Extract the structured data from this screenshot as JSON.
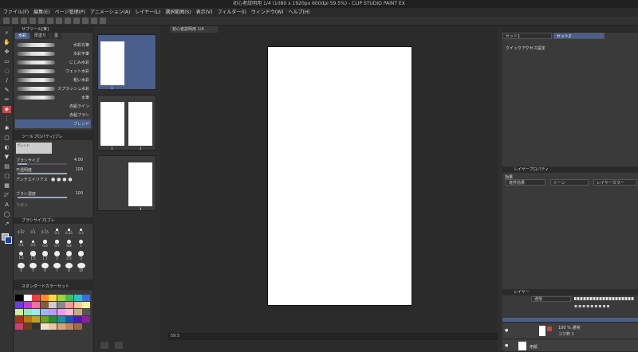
{
  "window": {
    "title": "初心者説明用 1/4 (1080 x 1920px 600dpi 59.5%) - CLIP STUDIO PAINT EX"
  },
  "menu": [
    "ファイル(F)",
    "編集(E)",
    "ページ管理(P)",
    "アニメーション(A)",
    "レイヤー(L)",
    "選択範囲(S)",
    "表示(V)",
    "フィルター(I)",
    "ウィンドウ(W)",
    "ヘルプ(H)"
  ],
  "subtool": {
    "header": "サブツール[筆]",
    "tabs": [
      "水彩",
      "厚塗り",
      "墨"
    ],
    "brushes": [
      "水彩丸筆",
      "水彩平筆",
      "にじみ水彩",
      "ウェット水彩",
      "粗い水彩",
      "スプラッシュ水彩",
      "水筆",
      "赤鉛ライン",
      "赤鉛ブラシ",
      "ブレンド"
    ]
  },
  "toolprop": {
    "header": "ツールプロパティ[ブレ",
    "preview_label": "ブレンド",
    "brush_size_label": "ブラシサイズ",
    "brush_size_val": "4.00",
    "opacity_label": "不透明度",
    "opacity_val": "100",
    "antialias_label": "アンチエイリアス",
    "brush_density_label": "ブラシ濃度",
    "brush_density_val": "100",
    "ribbon_label": "リボン"
  },
  "brushsize": {
    "header": "ブラシサイズ[ブレ",
    "sizes": [
      "0.07",
      "0.1",
      "0.15",
      "0.2",
      "0.25",
      "0.3",
      "0.4",
      "0.5",
      "0.6",
      "0.7",
      "0.8",
      "1",
      "1.2",
      "1.5",
      "1.7",
      "2",
      "2.5",
      "3",
      "4",
      "5",
      "6",
      "7",
      "8",
      "10"
    ]
  },
  "colorset": {
    "header": "スタンダードカラーセット",
    "colors": [
      "#000000",
      "#ffffff",
      "#ff3b3b",
      "#ff8a2a",
      "#ffd83a",
      "#9cd43a",
      "#3ac25a",
      "#2ac1c8",
      "#3b6ce0",
      "#6a3be0",
      "#c03bd0",
      "#ff6aa0",
      "#8a5a3a",
      "#cccccc",
      "#888888",
      "#ff9a9a",
      "#ffc79a",
      "#fff19a",
      "#cfee9a",
      "#9ae6b4",
      "#9aeaf0",
      "#9ab8f4",
      "#bf9af4",
      "#ef9af0",
      "#ffb8d0",
      "#caa986",
      "#555555",
      "#a6341c",
      "#b8741c",
      "#bfa21c",
      "#6f9f1c",
      "#1c8f3a",
      "#1c8f95",
      "#1c4fae",
      "#4a1cae",
      "#8f1ca2",
      "#cf3f6f",
      "#6a3f1f",
      "#333333",
      "#f2e1c8",
      "#e7c9a6",
      "#d4a57a",
      "#bd8760",
      "#9c6a46"
    ]
  },
  "pages": {
    "tiles": [
      {
        "label": "1"
      },
      {
        "labels": [
          "3",
          "2"
        ]
      },
      {
        "label": "4"
      }
    ]
  },
  "canvas": {
    "tab": "初心者説明用 1/4",
    "status_zoom": "59.5"
  },
  "right": {
    "set_tabs": [
      "セット1",
      "セット2"
    ],
    "quick_access": "クイックアクセス設定",
    "layer_prop_header": "レイヤープロパティ",
    "effect_label": "効果",
    "effects": [
      "境界効果",
      "トーン",
      "レイヤーカラー"
    ],
    "layer_header": "レイヤー",
    "blend_mode": "通常",
    "layers": [
      {
        "name": "コマ枠 1",
        "detail": "100 % 通常"
      },
      {
        "name": "用紙",
        "detail": ""
      }
    ]
  }
}
